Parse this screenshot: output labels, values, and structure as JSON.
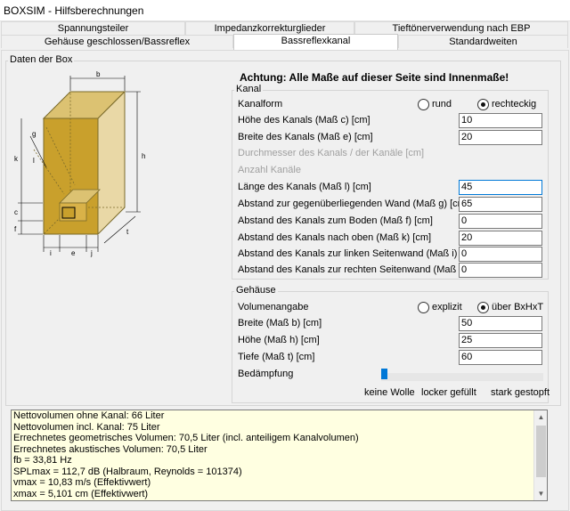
{
  "window": {
    "title": "BOXSIM - Hilfsberechnungen"
  },
  "tabs": {
    "row1": [
      "Spannungsteiler",
      "Impedanzkorrekturglieder",
      "Tieftönerverwendung nach EBP"
    ],
    "row2": [
      "Gehäuse geschlossen/Bassreflex",
      "Bassreflexkanal",
      "Standardweiten"
    ],
    "active": "Bassreflexkanal"
  },
  "box_group": {
    "caption": "Daten der Box"
  },
  "diagram_labels": {
    "b": "b",
    "h": "h",
    "t": "t",
    "g": "g",
    "k": "k",
    "l": "l",
    "c": "c",
    "f": "f",
    "i": "i",
    "e": "e",
    "j": "j"
  },
  "warning": "Achtung: Alle Maße auf dieser Seite sind Innenmaße!",
  "kanal": {
    "caption": "Kanal",
    "form_label": "Kanalform",
    "opt_rund": "rund",
    "opt_rechteckig": "rechteckig",
    "selected": "rechteckig",
    "hoehe_label": "Höhe des Kanals (Maß c) [cm]",
    "hoehe_value": "10",
    "breite_label": "Breite des Kanals (Maß e) [cm]",
    "breite_value": "20",
    "durchmesser_label": "Durchmesser des Kanals / der Kanäle [cm]",
    "anzahl_label": "Anzahl Kanäle",
    "laenge_label": "Länge des Kanals (Maß l) [cm]",
    "laenge_value": "45",
    "abst_wand_label": "Abstand zur gegenüberliegenden Wand (Maß g) [cm]",
    "abst_wand_value": "65",
    "abst_boden_label": "Abstand des Kanals zum Boden (Maß f) [cm]",
    "abst_boden_value": "0",
    "abst_oben_label": "Abstand des Kanals nach oben (Maß k) [cm]",
    "abst_oben_value": "20",
    "abst_links_label": "Abstand des Kanals zur linken Seitenwand (Maß i) [cm]",
    "abst_links_value": "0",
    "abst_rechts_label": "Abstand des Kanals zur rechten Seitenwand (Maß j) [cm]",
    "abst_rechts_value": "0"
  },
  "gehaeuse": {
    "caption": "Gehäuse",
    "vol_label": "Volumenangabe",
    "opt_explizit": "explizit",
    "opt_bxhxt": "über BxHxT",
    "selected": "über BxHxT",
    "breite_label": "Breite (Maß b) [cm]",
    "breite_value": "50",
    "hoehe_label": "Höhe (Maß h) [cm]",
    "hoehe_value": "25",
    "tiefe_label": "Tiefe (Maß t) [cm]",
    "tiefe_value": "60",
    "daempfung_label": "Bedämpfung",
    "daempfung_level": 0,
    "slider_labels": [
      "keine Wolle",
      "locker gefüllt",
      "stark gestopft"
    ]
  },
  "output_lines": [
    "Nettovolumen ohne Kanal: 66 Liter",
    "Nettovolumen incl. Kanal: 75 Liter",
    "Errechnetes geometrisches Volumen: 70,5 Liter (incl. anteiligem Kanalvolumen)",
    "Errechnetes akustisches Volumen: 70,5 Liter",
    "fb = 33,81 Hz",
    "SPLmax = 112,7 dB (Halbraum, Reynolds = 101374)",
    "vmax = 10,83 m/s (Effektivwert)",
    "xmax = 5,101 cm (Effektivwert)"
  ],
  "colors": {
    "box_front": "#c9a02c",
    "box_side": "#e9d8a6",
    "box_top": "#dcc272",
    "accent": "#0078d7",
    "output_bg": "#ffffe1"
  }
}
